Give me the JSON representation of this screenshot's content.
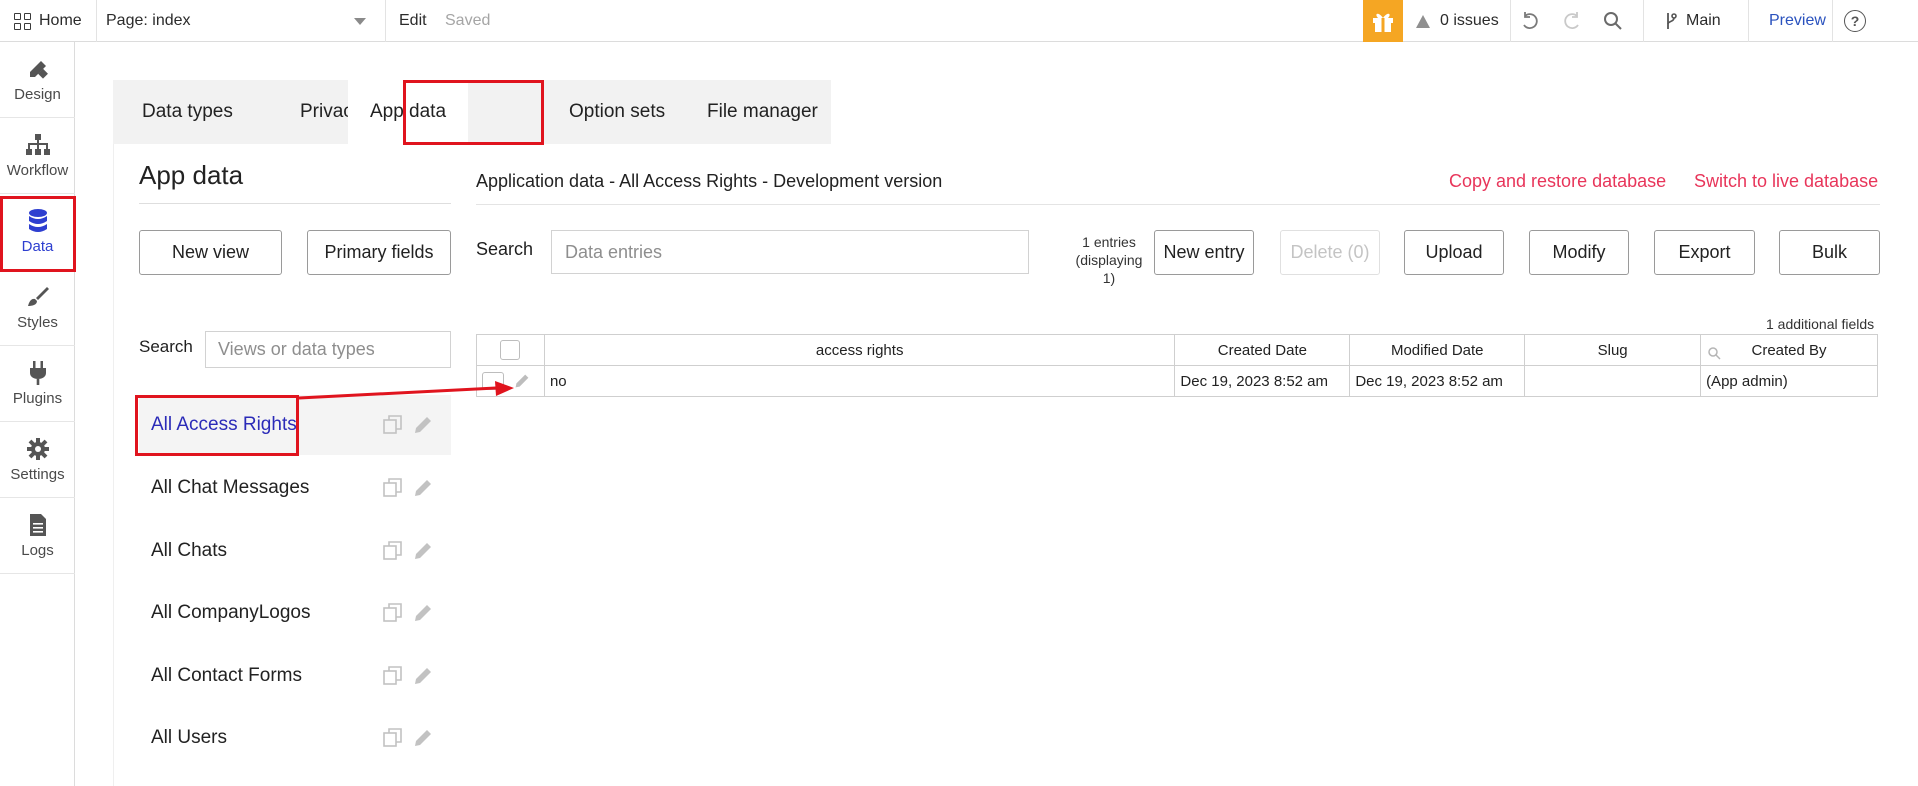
{
  "topbar": {
    "home_label": "Home",
    "page_label": "Page: index",
    "edit_label": "Edit",
    "saved_label": "Saved",
    "issues_label": "0 issues",
    "branch_label": "Main",
    "preview_label": "Preview",
    "help_glyph": "?"
  },
  "rail": {
    "items": [
      {
        "label": "Design",
        "icon": "pencil-ruler-icon"
      },
      {
        "label": "Workflow",
        "icon": "sitemap-icon"
      },
      {
        "label": "Data",
        "icon": "database-icon",
        "active": true
      },
      {
        "label": "Styles",
        "icon": "brush-icon"
      },
      {
        "label": "Plugins",
        "icon": "plug-icon"
      },
      {
        "label": "Settings",
        "icon": "gear-icon"
      },
      {
        "label": "Logs",
        "icon": "file-icon"
      }
    ]
  },
  "tabs": [
    {
      "label": "Data types"
    },
    {
      "label": "Privacy"
    },
    {
      "label": "App data",
      "active": true
    },
    {
      "label": "Option sets"
    },
    {
      "label": "File manager"
    }
  ],
  "left": {
    "title": "App data",
    "new_view_label": "New view",
    "primary_fields_label": "Primary fields",
    "search_label": "Search",
    "search_placeholder": "Views or data types",
    "views": [
      {
        "label": "All Access Rights",
        "active": true
      },
      {
        "label": "All Chat Messages"
      },
      {
        "label": "All Chats"
      },
      {
        "label": "All CompanyLogos"
      },
      {
        "label": "All Contact Forms"
      },
      {
        "label": "All Users"
      }
    ]
  },
  "right": {
    "heading": "Application data - All Access Rights - Development version",
    "copy_restore_label": "Copy and restore database",
    "switch_live_label": "Switch to live database",
    "search_label": "Search",
    "search_placeholder": "Data entries",
    "entries_count_line1": "1 entries",
    "entries_count_line2": "(displaying",
    "entries_count_line3": "1)",
    "new_entry_label": "New entry",
    "delete_label": "Delete (0)",
    "upload_label": "Upload",
    "modify_label": "Modify",
    "export_label": "Export",
    "bulk_label": "Bulk",
    "additional_fields": "1 additional fields",
    "columns": [
      "access rights",
      "Created Date",
      "Modified Date",
      "Slug",
      "Created By"
    ],
    "rows": [
      {
        "access_rights": "no",
        "created": "Dec 19, 2023 8:52 am",
        "modified": "Dec 19, 2023 8:52 am",
        "slug": "",
        "created_by": "(App admin)"
      }
    ]
  },
  "colors": {
    "accent": "#2e3fd0",
    "highlight": "#e0141e",
    "link_red": "#e8355a",
    "gift": "#f5a623"
  }
}
